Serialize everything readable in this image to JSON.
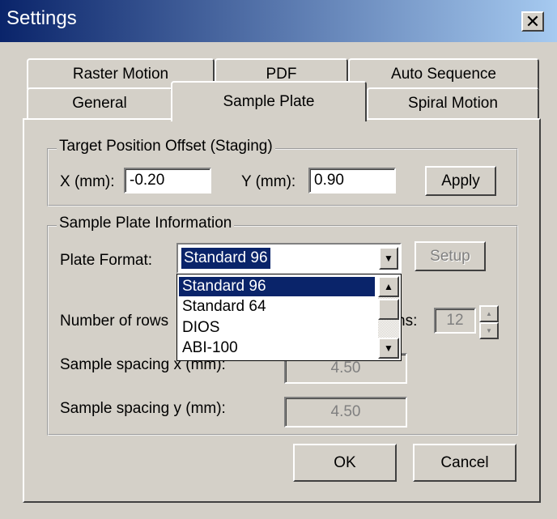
{
  "window": {
    "title": "Settings",
    "close_glyph": "✕"
  },
  "tabs": {
    "row1": [
      "Raster Motion",
      "PDF",
      "Auto Sequence"
    ],
    "row2": [
      "General",
      "Sample Plate",
      "Spiral Motion"
    ],
    "active": "Sample Plate"
  },
  "target_offset": {
    "legend": "Target Position Offset (Staging)",
    "x_label": "X (mm):",
    "x_value": "-0.20",
    "y_label": "Y (mm):",
    "y_value": "0.90",
    "apply_label": "Apply"
  },
  "plate_info": {
    "legend": "Sample Plate Information",
    "format_label": "Plate Format:",
    "format_value": "Standard 96",
    "setup_label": "Setup",
    "format_options": [
      "Standard 96",
      "Standard 64",
      "DIOS",
      "ABI-100"
    ],
    "rows_label": "Number of rows",
    "cols_label": "ns:",
    "cols_value": "12",
    "spacing_x_label": "Sample spacing x (mm):",
    "spacing_x_value": "4.50",
    "spacing_y_label": "Sample spacing y (mm):",
    "spacing_y_value": "4.50"
  },
  "footer": {
    "ok_label": "OK",
    "cancel_label": "Cancel"
  },
  "icons": {
    "close": "close-icon",
    "dropdown_arrow": "chevron-down-icon",
    "scroll_up": "arrow-up-icon",
    "scroll_down": "arrow-down-icon"
  },
  "colors": {
    "titlebar_start": "#0a246a",
    "titlebar_end": "#a6caf0",
    "selection": "#0a246a",
    "face": "#d4d0c8"
  }
}
